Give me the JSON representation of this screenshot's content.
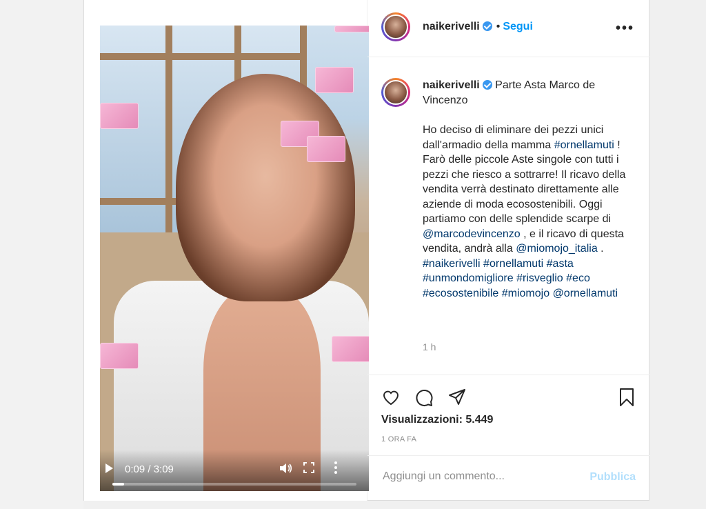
{
  "post": {
    "username": "naikerivelli",
    "follow_label": "Segui",
    "dot": "•",
    "more": "•••"
  },
  "video": {
    "time": "0:09 / 3:09",
    "progress": 0.048
  },
  "caption": {
    "username": "naikerivelli",
    "title": "Parte Asta Marco de Vincenzo",
    "body": [
      {
        "t": "text",
        "v": "Ho deciso di eliminare dei pezzi unici dall'armadio della mamma "
      },
      {
        "t": "tag",
        "v": "#ornellamuti"
      },
      {
        "t": "text",
        "v": " ! Farò delle piccole Aste singole con tutti i pezzi che riesco a sottrarre! Il ricavo della vendita verrà destinato direttamente alle aziende di moda ecosostenibili. Oggi partiamo con delle splendide scarpe di "
      },
      {
        "t": "tag",
        "v": "@marcodevincenzo"
      },
      {
        "t": "text",
        "v": " , e il ricavo di questa vendita, andrà alla "
      },
      {
        "t": "tag",
        "v": "@miomojo_italia"
      },
      {
        "t": "text",
        "v": " . "
      },
      {
        "t": "tag",
        "v": "#naikerivelli"
      },
      {
        "t": "text",
        "v": " "
      },
      {
        "t": "tag",
        "v": "#ornellamuti"
      },
      {
        "t": "text",
        "v": " "
      },
      {
        "t": "tag",
        "v": "#asta"
      },
      {
        "t": "text",
        "v": " "
      },
      {
        "t": "tag",
        "v": "#unmondomigliore"
      },
      {
        "t": "text",
        "v": " "
      },
      {
        "t": "tag",
        "v": "#risveglio"
      },
      {
        "t": "text",
        "v": " "
      },
      {
        "t": "tag",
        "v": "#eco"
      },
      {
        "t": "text",
        "v": " "
      },
      {
        "t": "tag",
        "v": "#ecosostenibile"
      },
      {
        "t": "text",
        "v": " "
      },
      {
        "t": "tag",
        "v": "#miomojo"
      },
      {
        "t": "text",
        "v": " "
      },
      {
        "t": "tag",
        "v": "@ornellamuti"
      }
    ],
    "time_ago": "1 h"
  },
  "actions": {
    "views": "Visualizzazioni: 5.449",
    "date": "1 ORA FA"
  },
  "comment_box": {
    "placeholder": "Aggiungi un commento...",
    "publish_label": "Pubblica"
  },
  "colors": {
    "link": "#00376b",
    "follow": "#0095f6",
    "publish_disabled": "#b2dffc",
    "verified": "#3897f0"
  }
}
